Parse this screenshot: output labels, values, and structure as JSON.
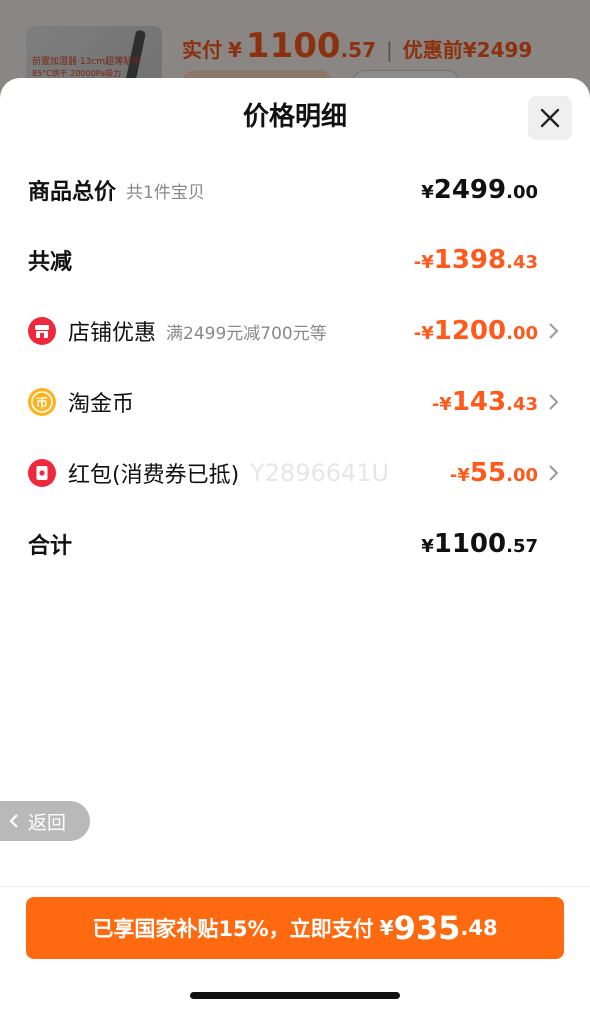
{
  "background": {
    "thumb_line1": "前置加湿器·13cm超薄贴平",
    "thumb_line2": "85°C烘干 20000Pa吸力",
    "pay_label": "实付",
    "pay_symbol": "¥",
    "pay_int": "1100",
    "pay_dec": ".57",
    "before_label": "优惠前",
    "before_value": "¥2499"
  },
  "sheet": {
    "title": "价格明细",
    "close_icon": "close-icon"
  },
  "rows": {
    "total": {
      "label": "商品总价",
      "sub": "共1件宝贝",
      "sym": "¥",
      "int": "2499",
      "dec": ".00"
    },
    "reduce": {
      "label": "共减",
      "sym": "-¥",
      "int": "1398",
      "dec": ".43"
    },
    "shop": {
      "label": "店铺优惠",
      "sub": "满2499元减700元等",
      "sym": "-¥",
      "int": "1200",
      "dec": ".00",
      "icon": "shop-icon"
    },
    "coin": {
      "label": "淘金币",
      "sym": "-¥",
      "int": "143",
      "dec": ".43",
      "icon": "coin-icon"
    },
    "redpack": {
      "label": "红包(消费券已抵)",
      "sym": "-¥",
      "int": "55",
      "dec": ".00",
      "icon": "red-packet-icon",
      "watermark": "Y2896641U"
    },
    "sum": {
      "label": "合计",
      "sym": "¥",
      "int": "1100",
      "dec": ".57"
    }
  },
  "back": {
    "label": "返回"
  },
  "pay_button": {
    "text": "已享国家补贴15%，立即支付",
    "sym": "¥",
    "int": "935",
    "dec": ".48"
  },
  "colors": {
    "accent": "#ff6a10",
    "discount": "#ff5a1c",
    "text": "#111111",
    "muted": "#888888"
  }
}
